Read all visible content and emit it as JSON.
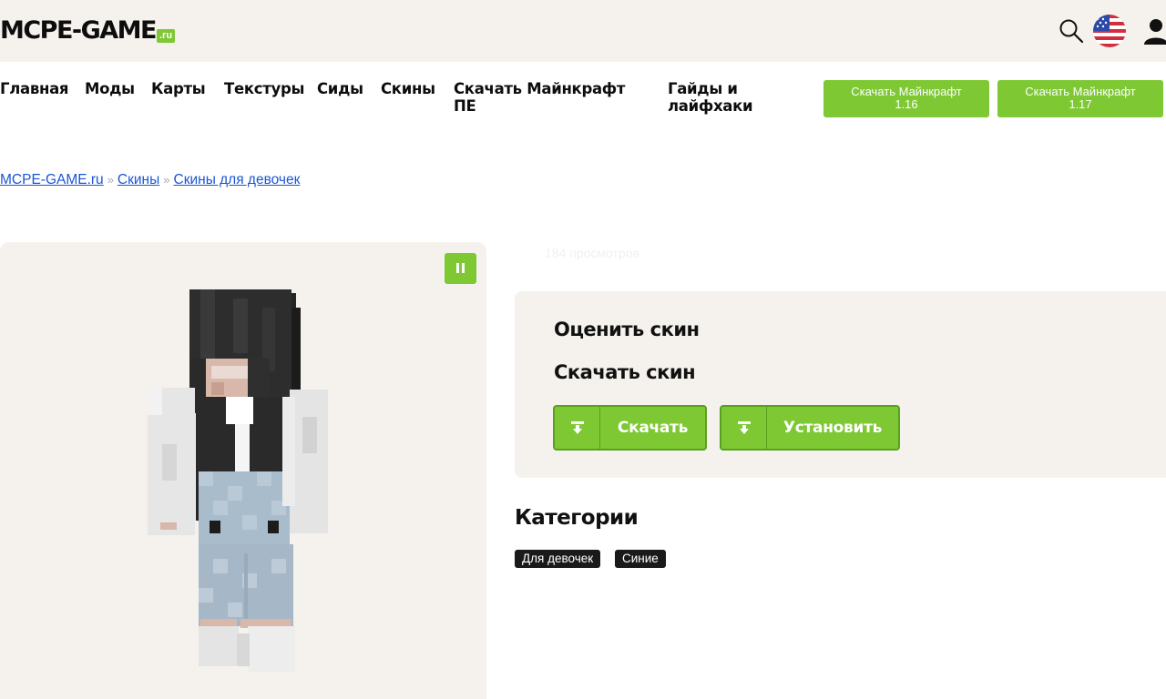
{
  "header": {
    "logo_text": "MCPE-GAME",
    "logo_suffix": ".ru",
    "icons": [
      "search-icon",
      "us-flag-icon",
      "user-icon"
    ]
  },
  "nav": {
    "items": [
      {
        "label": "Главная"
      },
      {
        "label": "Моды"
      },
      {
        "label": "Карты"
      },
      {
        "label": "Текстуры"
      },
      {
        "label": "Сиды"
      },
      {
        "label": "Скины"
      },
      {
        "label": "Скачать Майнкрафт ПЕ"
      },
      {
        "label": "Гайды и лайфхаки"
      }
    ],
    "buttons": [
      {
        "label": "Скачать Майнкрафт 1.16"
      },
      {
        "label": "Скачать Майнкрафт 1.17"
      }
    ]
  },
  "breadcrumb": {
    "items": [
      "MCPE-GAME.ru",
      "Скины",
      "Скины для девочек"
    ],
    "separator": "»"
  },
  "skin": {
    "views": "184 просмотров",
    "pause_icon": "pause-icon"
  },
  "actions": {
    "rate_title": "Оценить скин",
    "download_title": "Скачать скин",
    "download_button": "Скачать",
    "install_button": "Установить"
  },
  "categories": {
    "title": "Категории",
    "tags": [
      "Для девочек",
      "Синие"
    ]
  },
  "colors": {
    "accent": "#7dc833",
    "link": "#1a56d6",
    "panel": "#f5f2ed"
  }
}
